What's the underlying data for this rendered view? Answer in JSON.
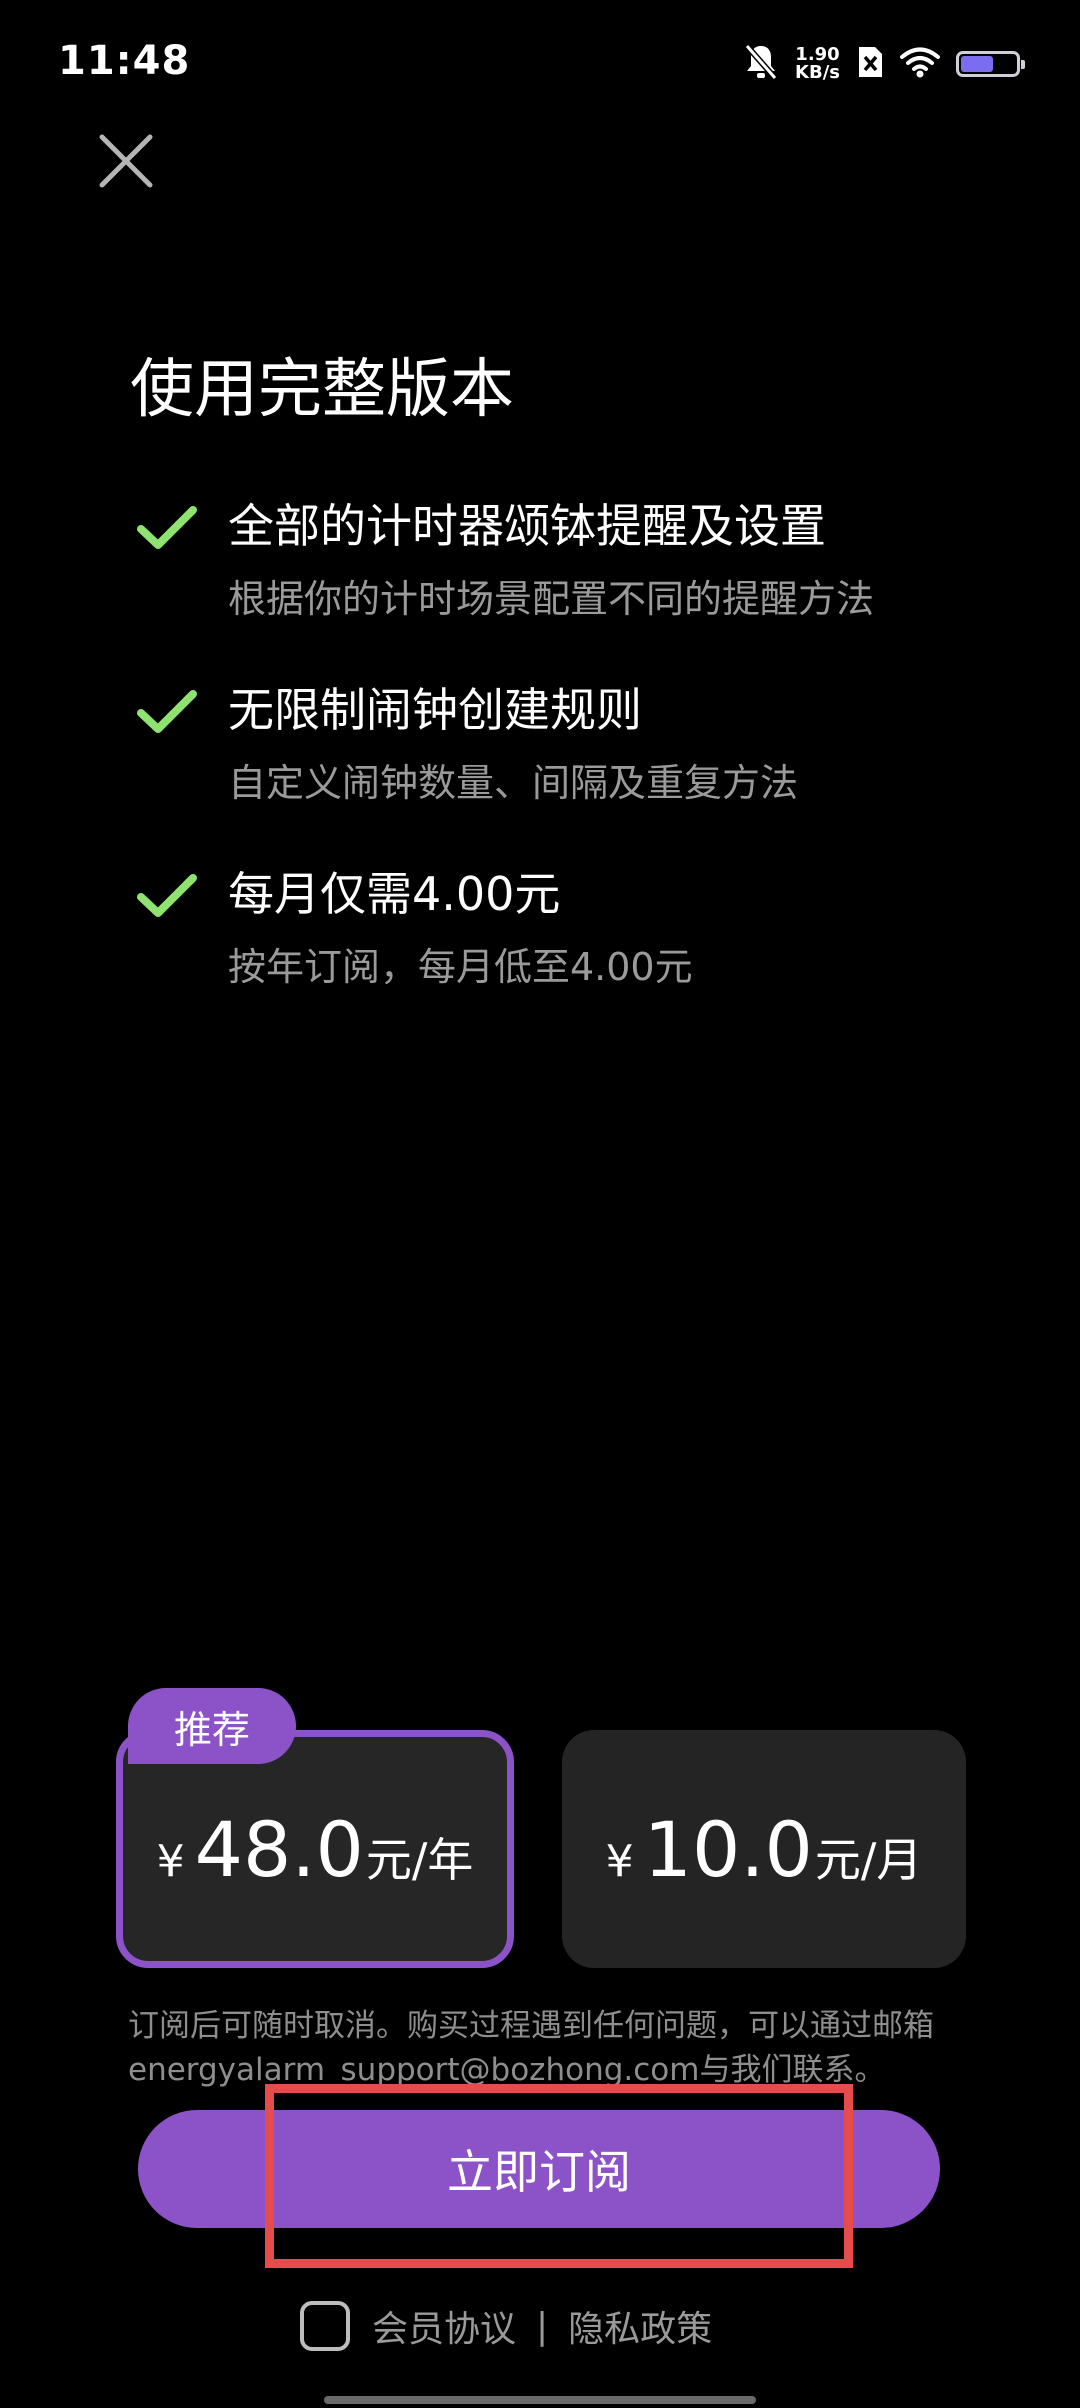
{
  "status_bar": {
    "time": "11:48",
    "net_speed_value": "1.90",
    "net_speed_unit": "KB/s",
    "battery_level": 0.6
  },
  "page": {
    "title": "使用完整版本"
  },
  "features": [
    {
      "title": "全部的计时器颂钵提醒及设置",
      "subtitle": "根据你的计时场景配置不同的提醒方法"
    },
    {
      "title": "无限制闹钟创建规则",
      "subtitle": "自定义闹钟数量、间隔及重复方法"
    },
    {
      "title": "每月仅需4.00元",
      "subtitle": "按年订阅，每月低至4.00元"
    }
  ],
  "plans": {
    "badge": "推荐",
    "yearly": {
      "currency": "¥",
      "amount": "48.0",
      "unit": "元/年"
    },
    "monthly": {
      "currency": "¥",
      "amount": "10.0",
      "unit": "元/月"
    }
  },
  "notice": {
    "line1": "订阅后可随时取消。购买过程遇到任何问题，可以通过邮箱",
    "line2": "energyalarm_support@bozhong.com与我们联系。"
  },
  "subscribe_label": "立即订阅",
  "footer": {
    "agreement": "会员协议",
    "separator": "|",
    "privacy": "隐私政策"
  },
  "colors": {
    "accent": "#8c53c8",
    "check": "#8fe26f",
    "highlight": "#e74c4c"
  }
}
